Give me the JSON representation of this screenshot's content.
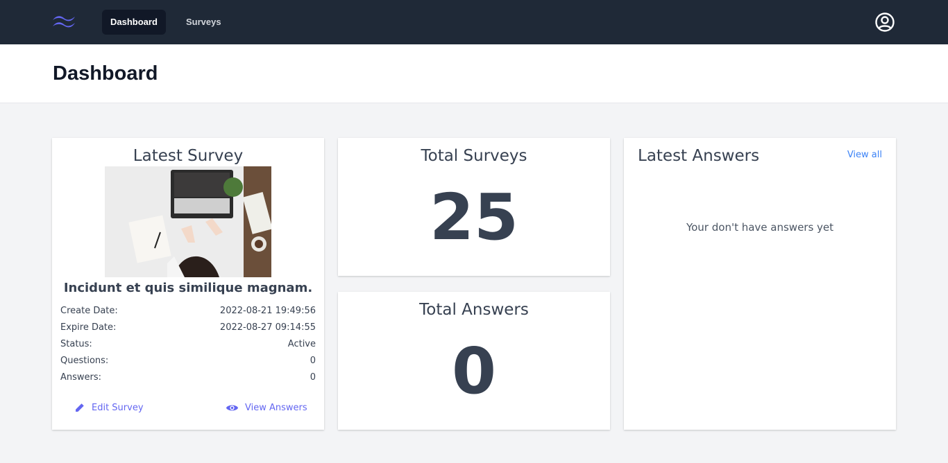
{
  "nav": {
    "links": [
      {
        "label": "Dashboard",
        "active": true
      },
      {
        "label": "Surveys",
        "active": false
      }
    ],
    "colors": {
      "bg": "#1f2937",
      "active_bg": "#111827",
      "logo": "#6366f1"
    }
  },
  "header": {
    "title": "Dashboard"
  },
  "latest_survey": {
    "title": "Latest Survey",
    "name": "Incidunt et quis similique magnam.",
    "image": "laptop-desk-photo",
    "fields": [
      {
        "label": "Create Date:",
        "value": "2022-08-21 19:49:56"
      },
      {
        "label": "Expire Date:",
        "value": "2022-08-27 09:14:55"
      },
      {
        "label": "Status:",
        "value": "Active"
      },
      {
        "label": "Questions:",
        "value": "0"
      },
      {
        "label": "Answers:",
        "value": "0"
      }
    ],
    "actions": {
      "edit": {
        "label": "Edit Survey",
        "icon": "pencil-icon"
      },
      "view": {
        "label": "View Answers",
        "icon": "eye-icon"
      }
    }
  },
  "total_surveys": {
    "title": "Total Surveys",
    "value": "25"
  },
  "total_answers": {
    "title": "Total Answers",
    "value": "0"
  },
  "latest_answers": {
    "title": "Latest Answers",
    "view_all": "View all",
    "empty_text": "Your don't have answers yet"
  },
  "colors": {
    "accent": "#6366f1",
    "link": "#3b82f6",
    "text": "#374151",
    "page_bg": "#f3f4f6"
  }
}
